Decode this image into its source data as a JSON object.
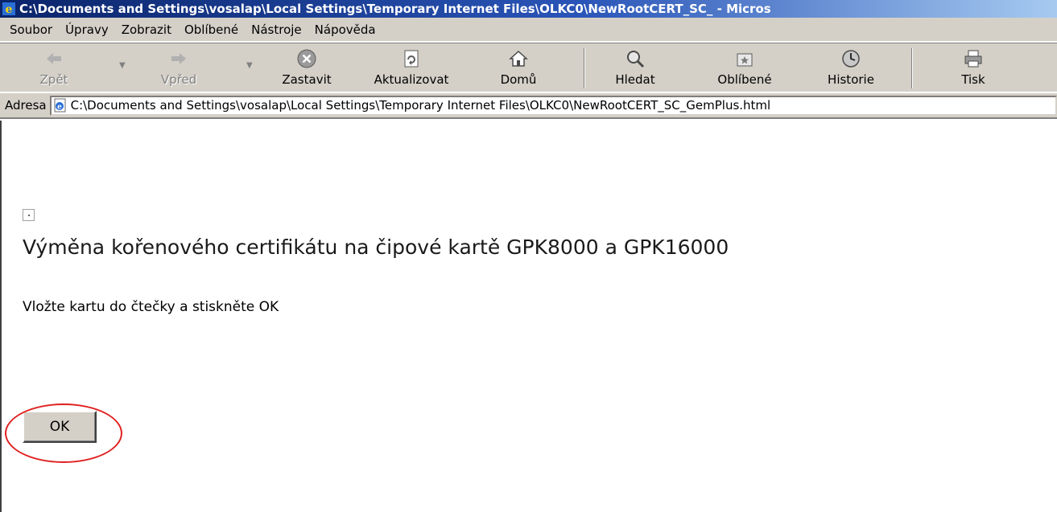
{
  "window": {
    "title": "C:\\Documents and Settings\\vosalap\\Local Settings\\Temporary Internet Files\\OLKC0\\NewRootCERT_SC_ - Micros"
  },
  "menu": {
    "items": [
      "Soubor",
      "Úpravy",
      "Zobrazit",
      "Oblíbené",
      "Nástroje",
      "Nápověda"
    ]
  },
  "toolbar": {
    "back": "Zpět",
    "forward": "Vpřed",
    "stop": "Zastavit",
    "refresh": "Aktualizovat",
    "home": "Domů",
    "search": "Hledat",
    "favorites": "Oblíbené",
    "history": "Historie",
    "print": "Tisk"
  },
  "address": {
    "label": "Adresa",
    "value": "C:\\Documents and Settings\\vosalap\\Local Settings\\Temporary Internet Files\\OLKC0\\NewRootCERT_SC_GemPlus.html"
  },
  "page": {
    "heading": "Výměna kořenového certifikátu na čipové kartě GPK8000 a GPK16000",
    "instruction": "Vložte kartu do čtečky a stiskněte OK",
    "ok_label": "OK"
  },
  "colors": {
    "titlebar": "#0a246a",
    "chrome": "#d4d0c8",
    "highlight": "#e02020"
  },
  "icons": {
    "window": "ie-icon",
    "address": "page-icon",
    "image": "broken-image-icon"
  }
}
